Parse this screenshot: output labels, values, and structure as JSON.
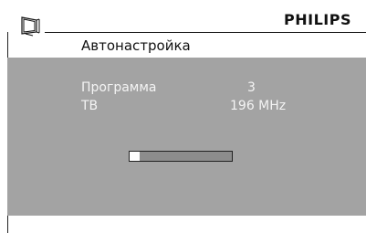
{
  "header": {
    "brand": "PHILIPS",
    "icon": "tv-icon"
  },
  "menu": {
    "title": "Автонастройка",
    "rows": [
      {
        "label": "Программа",
        "value": "3"
      },
      {
        "label": "ТВ",
        "value": "196 MHz"
      }
    ],
    "progress": 0.1
  },
  "colors": {
    "panel": "#a3a3a3",
    "text_light": "#f4f4f4",
    "progress_track": "#8c8c8c",
    "progress_fill": "#ffffff"
  }
}
